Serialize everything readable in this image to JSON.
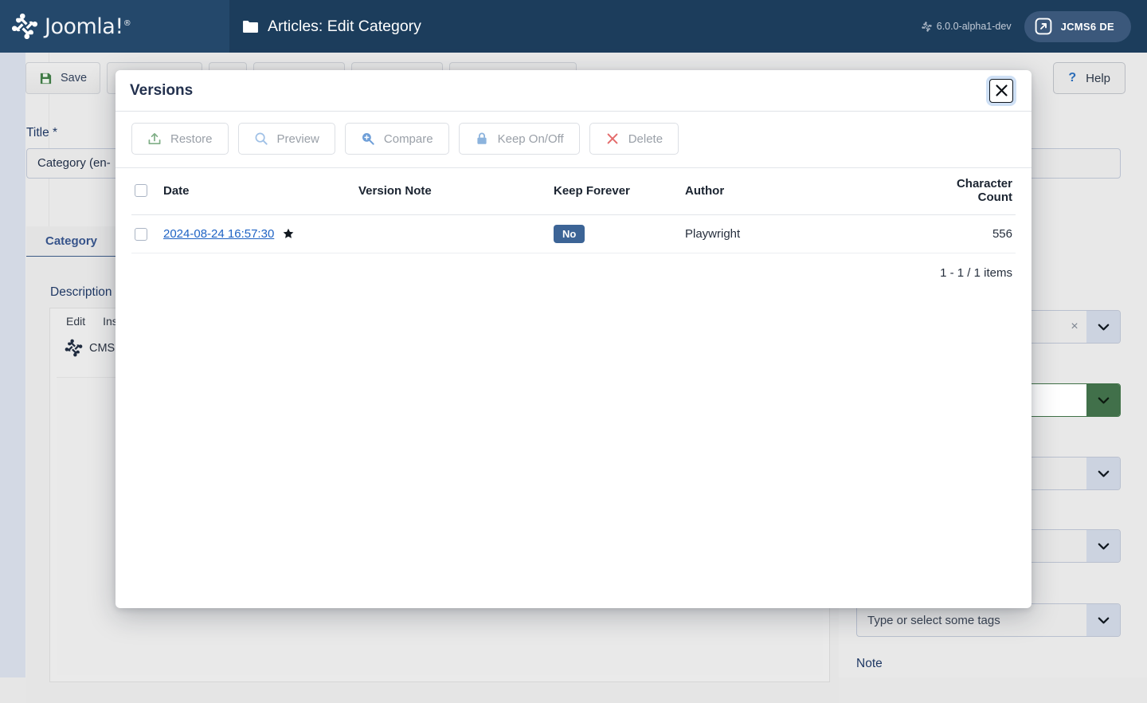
{
  "header": {
    "brand": "Joomla!",
    "brand_sup": "®",
    "page_title": "Articles: Edit Category",
    "folder_icon": "folder-icon",
    "version": "6.0.0-alpha1-dev",
    "version_icon": "joomla-mark-icon",
    "site_button": "JCMS6 DE",
    "site_button_icon": "external-link-icon"
  },
  "background": {
    "toolbar": {
      "save_label": "Save",
      "save_icon": "floppy-disk-icon",
      "help_label": "Help",
      "help_icon": "question-mark-icon"
    },
    "title_label": "Title *",
    "title_value": "Category (en-",
    "tab_label": "Category",
    "description_label": "Description",
    "editor": {
      "menu": [
        "Edit",
        "Ins"
      ],
      "button": "CMS (",
      "joomla_icon": "joomla-mark-icon"
    },
    "right_column": {
      "tags_placeholder": "Type or select some tags",
      "note_label": "Note",
      "chevron_icon": "chevron-down-icon",
      "clear_icon": "close-small-icon",
      "accent_green": "#41704a"
    }
  },
  "modal": {
    "title": "Versions",
    "close_icon": "close-icon",
    "toolbar": [
      {
        "label": "Restore",
        "icon": "upload-icon",
        "icon_color": "#7fae86",
        "disabled": true
      },
      {
        "label": "Preview",
        "icon": "search-icon",
        "icon_color": "#9fc0e6",
        "disabled": true
      },
      {
        "label": "Compare",
        "icon": "search-plus-icon",
        "icon_color": "#6f9fd8",
        "disabled": true
      },
      {
        "label": "Keep On/Off",
        "icon": "lock-icon",
        "icon_color": "#8cb3dd",
        "disabled": true
      },
      {
        "label": "Delete",
        "icon": "times-icon",
        "icon_color": "#e46b6b",
        "disabled": true
      }
    ],
    "table": {
      "columns": [
        "Date",
        "Version Note",
        "Keep Forever",
        "Author",
        "Character Count"
      ],
      "select_all_name": "select-all-checkbox",
      "rows": [
        {
          "date": "2024-08-24 16:57:30",
          "starred": true,
          "star_icon": "star-icon",
          "version_note": "",
          "keep_forever": "No",
          "keep_forever_color": "#3c6496",
          "author": "Playwright",
          "character_count": "556"
        }
      ]
    },
    "pagination": "1 - 1 / 1 items"
  }
}
